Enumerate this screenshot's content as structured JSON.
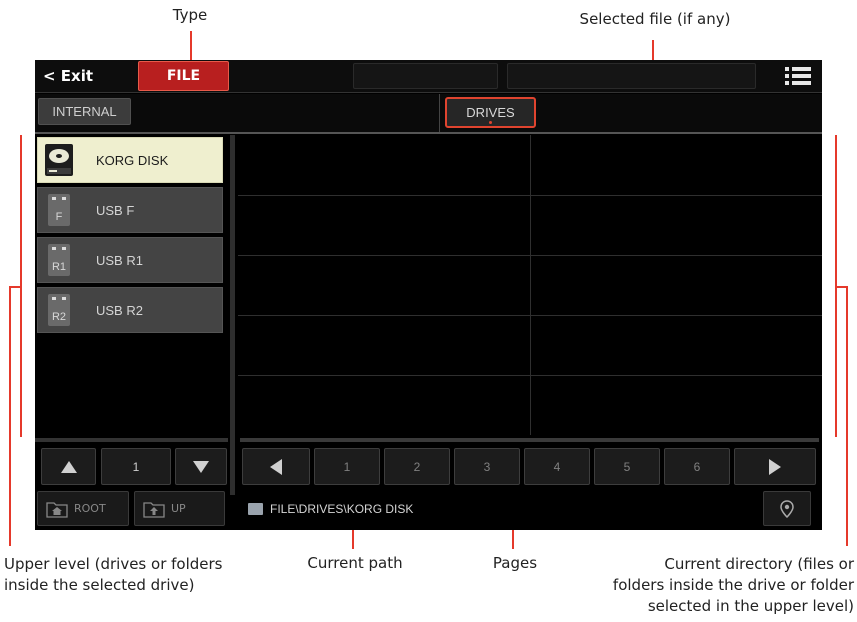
{
  "callouts": {
    "type": "Type",
    "selected_file": "Selected file (if any)",
    "upper_level": "Upper level (drives or folders\ninside the selected drive)",
    "current_path": "Current path",
    "pages": "Pages",
    "current_directory": "Current directory (files or\nfolders inside the drive or folder\nselected in the upper level)"
  },
  "topbar": {
    "exit_label": "< Exit",
    "type_label": "FILE",
    "menu_icon": "hamburger-list-icon"
  },
  "tabs": {
    "internal": "INTERNAL",
    "drives": "DRIVES"
  },
  "drives": [
    {
      "label": "KORG DISK",
      "icon": "disk-drive-icon",
      "badge": "",
      "selected": true
    },
    {
      "label": "USB F",
      "icon": "usb-drive-icon",
      "badge": "F",
      "selected": false
    },
    {
      "label": "USB R1",
      "icon": "usb-drive-icon",
      "badge": "R1",
      "selected": false
    },
    {
      "label": "USB R2",
      "icon": "usb-drive-icon",
      "badge": "R2",
      "selected": false
    }
  ],
  "left_nav": {
    "page": "1"
  },
  "pages": [
    "1",
    "2",
    "3",
    "4",
    "5",
    "6"
  ],
  "bottom": {
    "root_label": "ROOT",
    "up_label": "UP",
    "path": "FILE\\DRIVES\\KORG DISK",
    "location_icon": "location-pin-icon"
  },
  "colors": {
    "accent": "#b81f1f",
    "selected_row": "#efefcf",
    "callout_line": "#e5392b"
  }
}
